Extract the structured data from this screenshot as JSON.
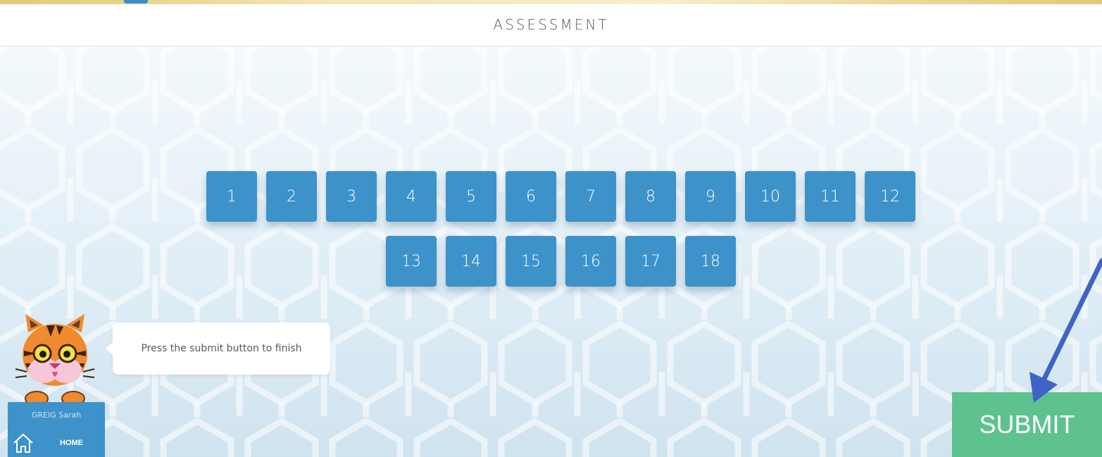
{
  "header": {
    "title": "ASSESSMENT"
  },
  "questions": {
    "row1": [
      "1",
      "2",
      "3",
      "4",
      "5",
      "6",
      "7",
      "8",
      "9",
      "10",
      "11",
      "12"
    ],
    "row2": [
      "13",
      "14",
      "15",
      "16",
      "17",
      "18"
    ]
  },
  "hint": {
    "text": "Press the submit button to finish"
  },
  "user": {
    "name": "GREIG Sarah",
    "home_label": "HOME"
  },
  "submit": {
    "label": "SUBMIT"
  },
  "colors": {
    "question_blue": "#3d92c9",
    "submit_green": "#5ec28f",
    "annotation_arrow": "#3f63c7"
  },
  "icons": [
    "home-icon",
    "tiger-mascot-icon",
    "annotation-arrow"
  ]
}
